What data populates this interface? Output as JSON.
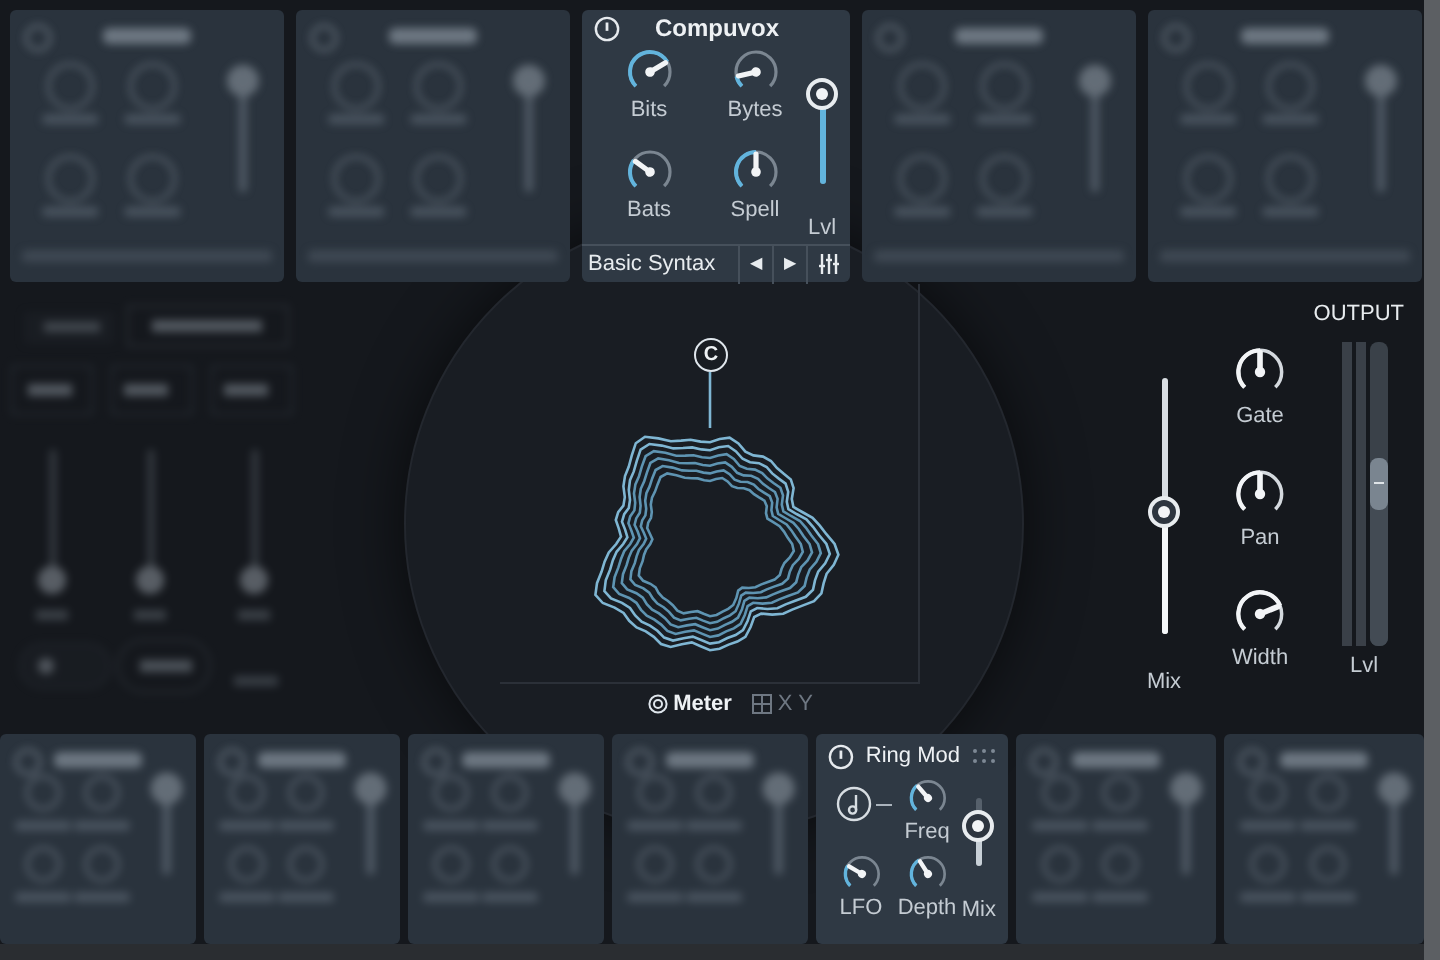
{
  "top_modules": [
    {
      "kind": "blurred"
    },
    {
      "kind": "blurred"
    },
    {
      "kind": "compuvox",
      "title": "Compuvox",
      "knobs": [
        {
          "label": "Bits",
          "level": 0.72
        },
        {
          "label": "Bytes",
          "level": 0.12
        },
        {
          "label": "Bats",
          "level": 0.3
        },
        {
          "label": "Spell",
          "level": 0.5
        }
      ],
      "slider": {
        "label": "Lvl",
        "level": 0.9
      },
      "preset": "Basic Syntax",
      "prev": "◀",
      "next": "▶"
    },
    {
      "kind": "blurred"
    },
    {
      "kind": "blurred"
    }
  ],
  "visualizer": {
    "node_label": "C",
    "view_tabs": [
      {
        "label": "Meter",
        "selected": true
      },
      {
        "label": "X Y",
        "selected": false
      }
    ]
  },
  "output": {
    "title": "OUTPUT",
    "mix": {
      "label": "Mix",
      "level": 0.48
    },
    "knobs": [
      {
        "label": "Gate",
        "level": 0.5
      },
      {
        "label": "Pan",
        "level": 0.5
      },
      {
        "label": "Width",
        "level": 0.75
      }
    ],
    "meter": {
      "label": "Lvl",
      "level": 0.62
    }
  },
  "bottom_modules": [
    {
      "kind": "blurred"
    },
    {
      "kind": "blurred"
    },
    {
      "kind": "blurred"
    },
    {
      "kind": "blurred"
    },
    {
      "kind": "ringmod",
      "title": "Ring Mod",
      "knobs": [
        {
          "label": "Freq",
          "level": 0.35
        },
        {
          "label": "LFO",
          "level": 0.28
        },
        {
          "label": "Depth",
          "level": 0.38
        }
      ],
      "mix": {
        "label": "Mix",
        "level": 0.6
      }
    },
    {
      "kind": "blurred"
    },
    {
      "kind": "blurred"
    }
  ]
}
